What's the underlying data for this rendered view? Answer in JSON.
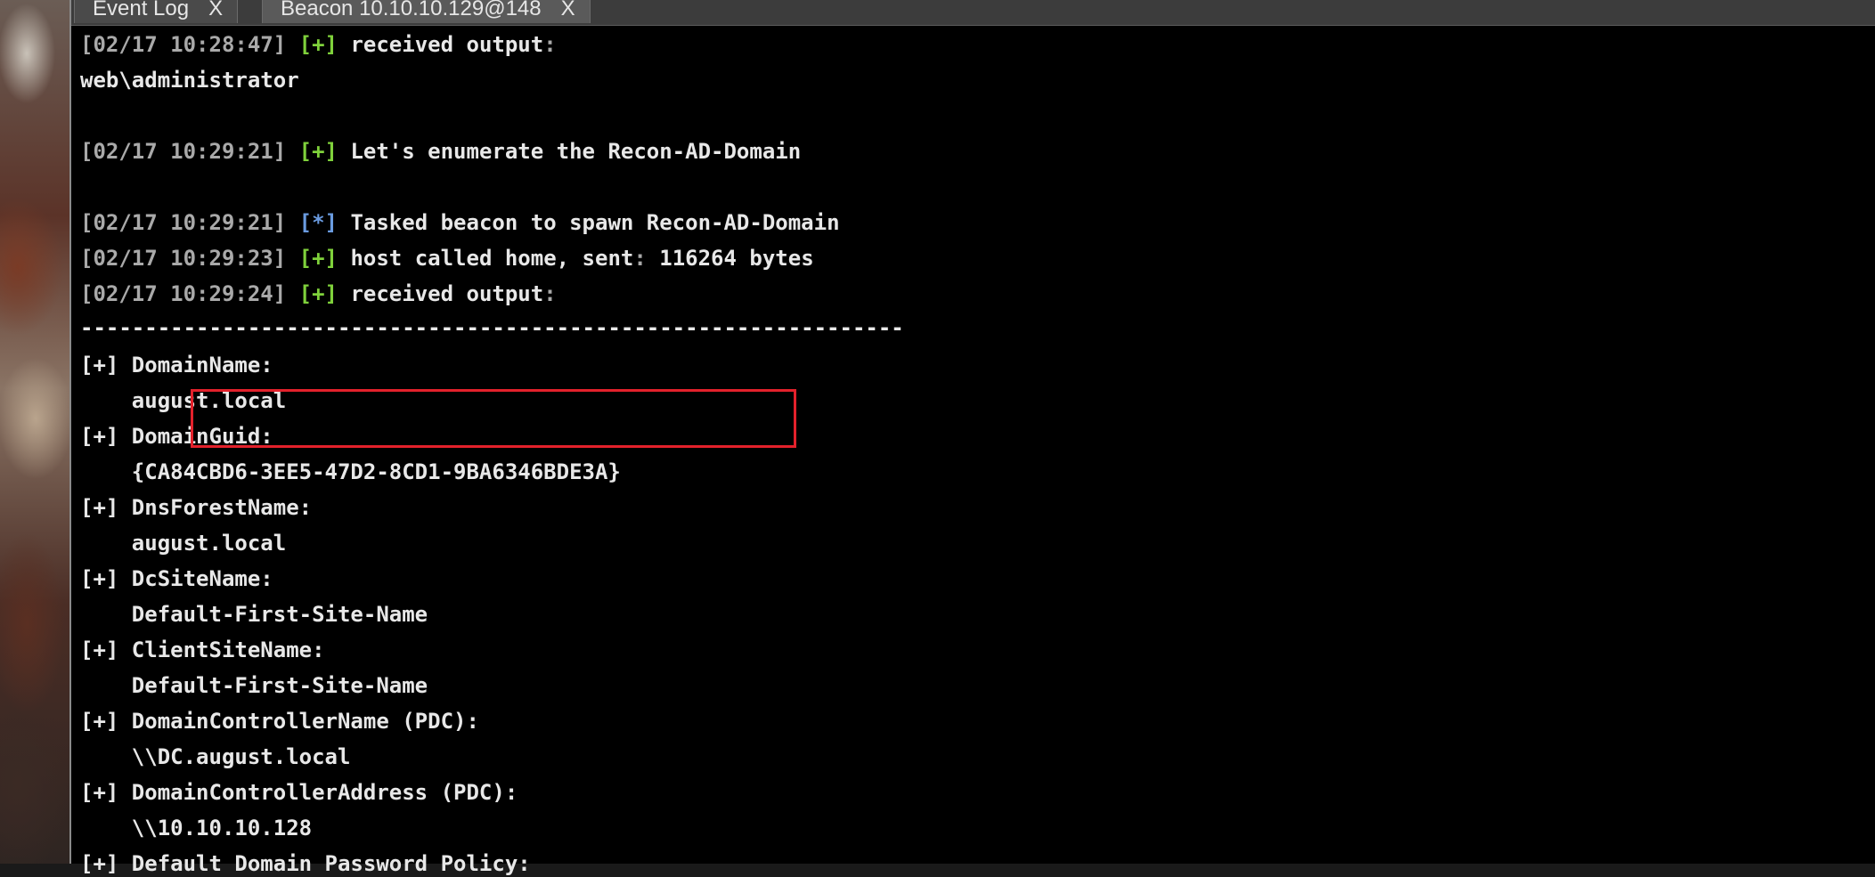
{
  "tabs": [
    {
      "label": "Event Log",
      "close": "X"
    },
    {
      "label": "Beacon 10.10.10.129@148",
      "close": "X"
    }
  ],
  "console": {
    "l1": {
      "ts": "[02/17 10:28:47]",
      "tag": "[+]",
      "text": "received output",
      "colon": ":"
    },
    "l2": {
      "text": "web\\administrator"
    },
    "l3": {
      "ts": "[02/17 10:29:21]",
      "tag": "[+]",
      "text": "Let's enumerate the Recon-AD-Domain"
    },
    "l4": {
      "ts": "[02/17 10:29:21]",
      "tag": "[*]",
      "text": "Tasked beacon to spawn Recon-AD-Domain"
    },
    "l5": {
      "ts": "[02/17 10:29:23]",
      "tag": "[+]",
      "text": "host called home, sent",
      "colon": ":",
      "value": "116264 bytes"
    },
    "l6": {
      "ts": "[02/17 10:29:24]",
      "tag": "[+]",
      "text": "received output",
      "colon": ":"
    },
    "separator": "----------------------------------------------------------------",
    "results": [
      {
        "key": "[+] DomainName:",
        "value": "    august.local"
      },
      {
        "key": "[+] DomainGuid:",
        "value": "    {CA84CBD6-3EE5-47D2-8CD1-9BA6346BDE3A}"
      },
      {
        "key": "[+] DnsForestName:",
        "value": "    august.local"
      },
      {
        "key": "[+] DcSiteName:",
        "value": "    Default-First-Site-Name"
      },
      {
        "key": "[+] ClientSiteName:",
        "value": "    Default-First-Site-Name"
      },
      {
        "key": "[+] DomainControllerName (PDC):",
        "value": "    \\\\DC.august.local"
      },
      {
        "key": "[+] DomainControllerAddress (PDC):",
        "value": "    \\\\10.10.10.128"
      }
    ],
    "last": "[+] Default Domain Password Policy:"
  },
  "colors": {
    "timestamp": "#a9a9a9",
    "plus": "#7fd13b",
    "star": "#6a9be0",
    "highlight": "#e3212b"
  }
}
